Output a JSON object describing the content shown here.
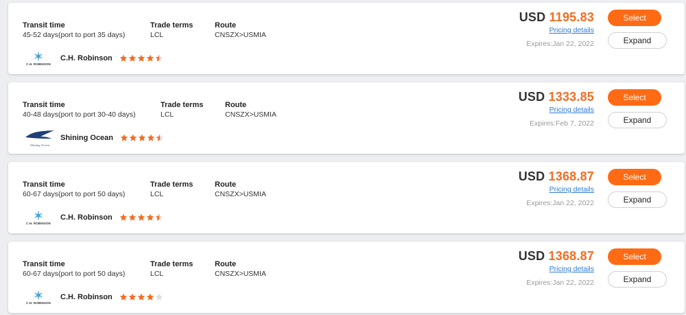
{
  "colors": {
    "accent": "#ff6a14",
    "price": "#f36c21",
    "link": "#2e7bd3",
    "muted": "#999999",
    "star_on": "#f36c21",
    "star_off": "#dddddd"
  },
  "labels": {
    "transit": "Transit time",
    "trade": "Trade terms",
    "route": "Route",
    "pricing": "Pricing details",
    "select": "Select",
    "expand": "Expand"
  },
  "quotes": [
    {
      "transit": "45-52 days(port to port 35 days)",
      "trade": "LCL",
      "route": "CNSZX>USMIA",
      "carrier": "C.H. Robinson",
      "logo_text": "C.H. ROBINSON",
      "logo_icon": "snowflake-logo-icon",
      "rating": 4.5,
      "currency": "USD",
      "amount": "1195.83",
      "expires": "Expires:Jan 22, 2022"
    },
    {
      "transit": "40-48 days(port to port 30-40 days)",
      "trade": "LCL",
      "route": "CNSZX>USMIA",
      "carrier": "Shining Ocean",
      "logo_text": "Shining Ocean",
      "logo_icon": "eagle-logo-icon",
      "rating": 4.5,
      "currency": "USD",
      "amount": "1333.85",
      "expires": "Expires:Feb 7, 2022"
    },
    {
      "transit": "60-67 days(port to port 50 days)",
      "trade": "LCL",
      "route": "CNSZX>USMIA",
      "carrier": "C.H. Robinson",
      "logo_text": "C.H. ROBINSON",
      "logo_icon": "snowflake-logo-icon",
      "rating": 4.5,
      "currency": "USD",
      "amount": "1368.87",
      "expires": "Expires:Jan 22, 2022"
    },
    {
      "transit": "60-67 days(port to port 50 days)",
      "trade": "LCL",
      "route": "CNSZX>USMIA",
      "carrier": "C.H. Robinson",
      "logo_text": "C.H. ROBINSON",
      "logo_icon": "snowflake-logo-icon",
      "rating": 4,
      "currency": "USD",
      "amount": "1368.87",
      "expires": "Expires:Jan 22, 2022"
    }
  ]
}
